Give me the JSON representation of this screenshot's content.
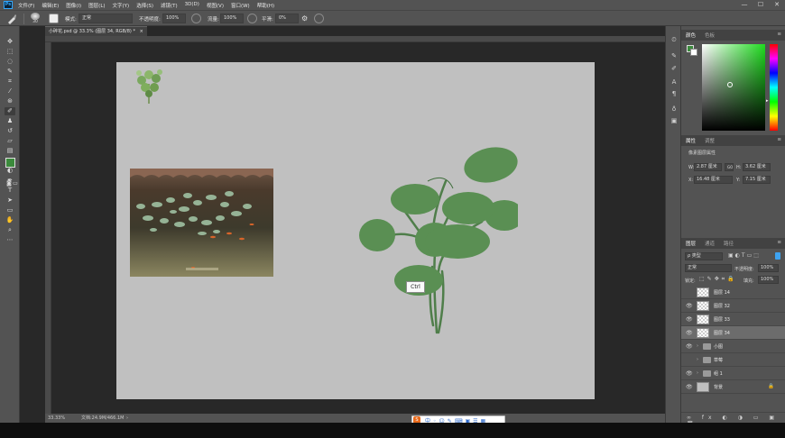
{
  "menubar": {
    "logo": "Ps",
    "items": [
      "文件(F)",
      "编辑(E)",
      "图像(I)",
      "图层(L)",
      "文字(Y)",
      "选择(S)",
      "滤镜(T)",
      "3D(D)",
      "视图(V)",
      "窗口(W)",
      "帮助(H)"
    ],
    "minimize": "—",
    "maximize": "☐",
    "close": "✕"
  },
  "options": {
    "brush_size": "30",
    "mode_label": "模式:",
    "mode_value": "正常",
    "opacity_label": "不透明度:",
    "opacity_value": "100%",
    "flow_label": "流量:",
    "flow_value": "100%",
    "smooth_label": "平滑:",
    "smooth_value": "0%"
  },
  "document": {
    "tab_title": "小碎花.psd @ 33.3% (图层 34, RGB/8) *",
    "tab_close": "×",
    "zoom": "33.33%",
    "doc_info": "文档:24.9M/466.1M",
    "tooltip": "Ctrl"
  },
  "color_panel": {
    "tabs": [
      "颜色",
      "色板"
    ],
    "foreground": "#3b8a3c",
    "background": "#ffffff",
    "picker_hue": "#1fdc1f"
  },
  "properties_panel": {
    "tabs": [
      "属性",
      "调整"
    ],
    "heading": "像素图层属性",
    "w_label": "W:",
    "w_value": "2.87 厘米",
    "h_label": "H:",
    "h_value": "3.62 厘米",
    "x_label": "X:",
    "x_value": "16.48 厘米",
    "y_label": "Y:",
    "y_value": "7.15 厘米",
    "link_icon": "GO"
  },
  "layers_panel": {
    "tabs": [
      "图层",
      "通道",
      "路径"
    ],
    "filter_label": "ρ 类型",
    "blend_mode": "正常",
    "opacity_label": "不透明度:",
    "opacity_value": "100%",
    "lock_label": "锁定:",
    "fill_label": "填充:",
    "fill_value": "100%",
    "layers": [
      {
        "name": "图层 14",
        "type": "pixel",
        "visible": false,
        "selected": false
      },
      {
        "name": "图层 32",
        "type": "pixel",
        "visible": true,
        "selected": false
      },
      {
        "name": "图层 33",
        "type": "pixel",
        "visible": true,
        "selected": false
      },
      {
        "name": "图层 34",
        "type": "pixel",
        "visible": true,
        "selected": true
      },
      {
        "name": "小图",
        "type": "group",
        "visible": true,
        "selected": false
      },
      {
        "name": "草莓",
        "type": "group",
        "visible": false,
        "selected": false
      },
      {
        "name": "组 1",
        "type": "group",
        "visible": true,
        "selected": false
      },
      {
        "name": "背景",
        "type": "background",
        "visible": true,
        "selected": false
      }
    ],
    "footer_icons": [
      "link-icon",
      "fx-icon",
      "mask-icon",
      "adjustment-icon",
      "group-icon",
      "new-layer-icon",
      "trash-icon"
    ]
  },
  "colors": {
    "panel_bg": "#535353",
    "canvas_bg": "#c0c0c0",
    "leaf_green": "#5a8f53",
    "accent": "#31a8ff"
  }
}
